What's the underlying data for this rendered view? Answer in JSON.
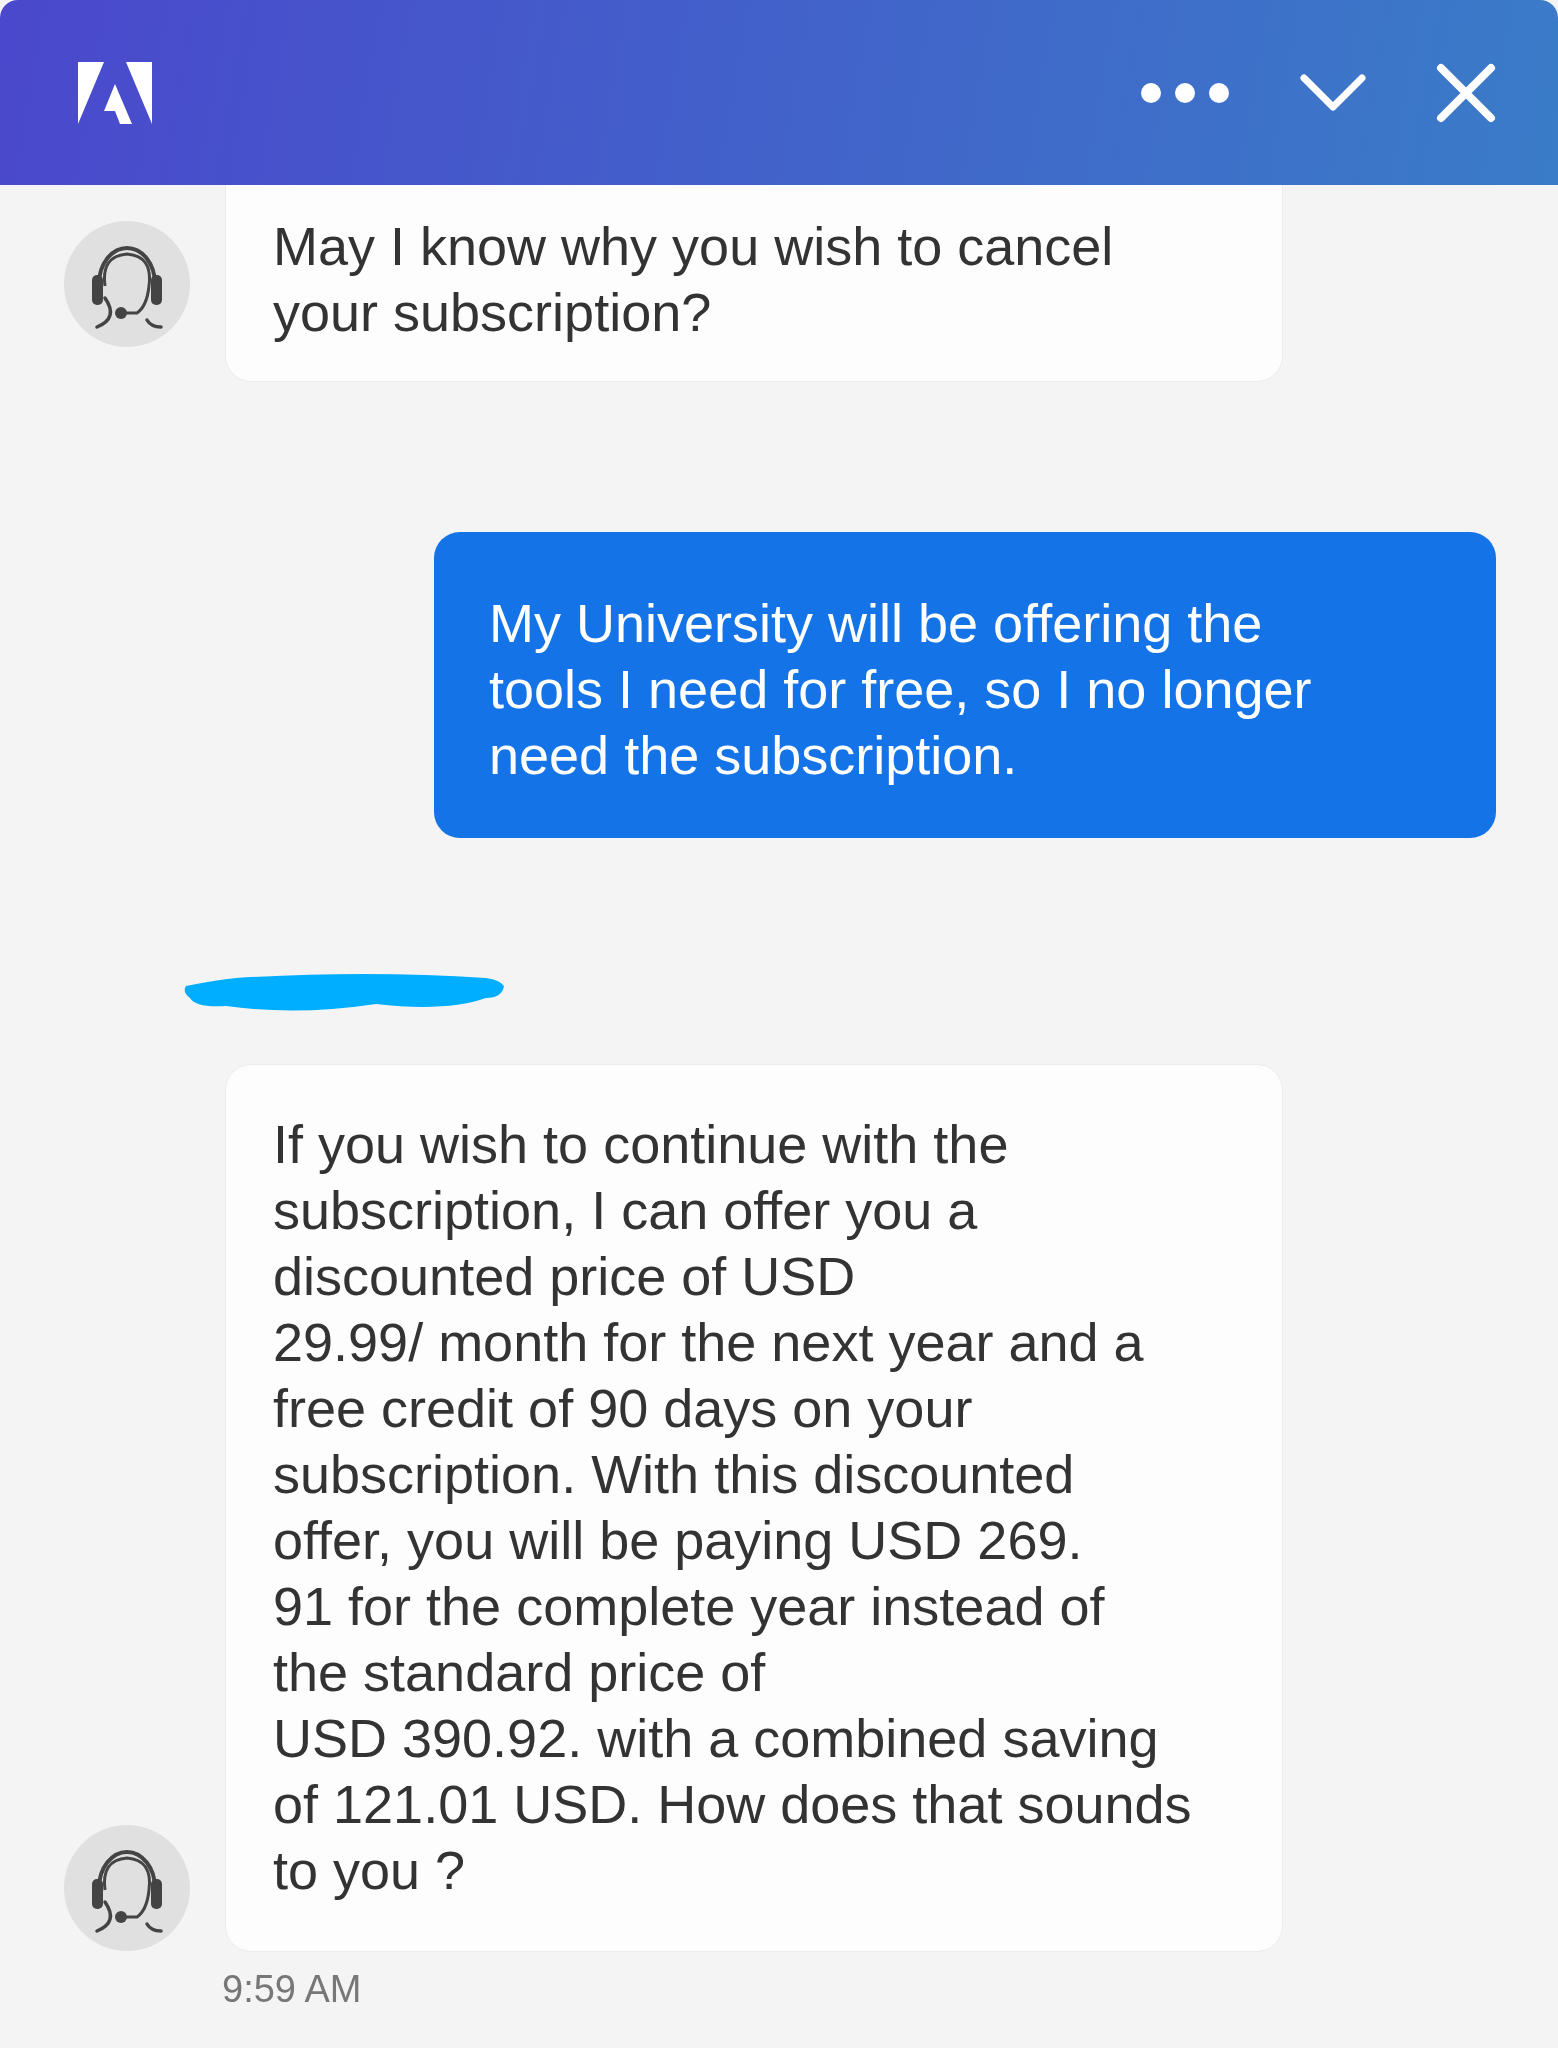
{
  "messages": [
    {
      "kind": "agent",
      "text": "May I know why you wish to cancel\nyour subscription?",
      "cut_top": true
    },
    {
      "kind": "user",
      "text": "My University will be offering the\ntools I need for free, so I no longer\nneed the subscription."
    },
    {
      "kind": "agent",
      "text": "If you wish to continue with the\nsubscription, I can offer you a\ndiscounted price of USD\n29.99/ month for the next year and a\nfree credit of 90 days on your\nsubscription. With this discounted\noffer, you will be paying USD 269.\n91 for the complete year instead of\nthe standard price of\nUSD 390.92. with a combined saving\nof 121.01 USD. How does that sounds\nto you ?",
      "redacted_sender": true,
      "time": "9:59 AM"
    }
  ]
}
